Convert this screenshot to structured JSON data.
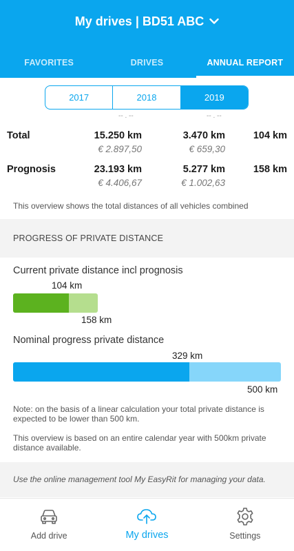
{
  "header": {
    "title": "My drives | BD51 ABC",
    "tabs": [
      {
        "label": "FAVORITES",
        "active": false
      },
      {
        "label": "DRIVES",
        "active": false
      },
      {
        "label": "ANNUAL REPORT",
        "active": true
      }
    ]
  },
  "years": [
    {
      "label": "2017",
      "active": false
    },
    {
      "label": "2018",
      "active": false
    },
    {
      "label": "2019",
      "active": true
    }
  ],
  "summary": {
    "total": {
      "label": "Total",
      "col1_km": "15.250 km",
      "col1_eur": "€ 2.897,50",
      "col2_km": "3.470 km",
      "col2_eur": "€ 659,30",
      "col3_km": "104 km"
    },
    "prognosis": {
      "label": "Prognosis",
      "col1_km": "23.193 km",
      "col1_eur": "€ 4.406,67",
      "col2_km": "5.277 km",
      "col2_eur": "€ 1.002,63",
      "col3_km": "158 km"
    },
    "note": "This overview shows the total distances of all vehicles combined"
  },
  "progress": {
    "section_title": "PROGRESS OF PRIVATE DISTANCE",
    "current": {
      "label": "Current private distance incl prognosis",
      "value_label": "104 km",
      "total_label": "158 km",
      "fraction": 0.658
    },
    "nominal": {
      "label": "Nominal progress private distance",
      "value_label": "329 km",
      "total_label": "500 km",
      "fraction": 0.658
    },
    "note1": "Note: on the basis of a linear calculation your total private distance is expected to be lower than 500 km.",
    "note2": "This overview is based on an entire calendar year with 500km private distance available."
  },
  "footer_info": "Use the online management tool My EasyRit for managing your data.",
  "colors": {
    "accent": "#0aa6ee",
    "green": "#5cb21f",
    "green_light": "#b5de8e",
    "blue_light": "#86d6fa"
  },
  "bottom_nav": [
    {
      "label": "Add drive",
      "icon": "car-icon",
      "active": false
    },
    {
      "label": "My drives",
      "icon": "cloud-upload-icon",
      "active": true
    },
    {
      "label": "Settings",
      "icon": "gear-icon",
      "active": false
    }
  ]
}
